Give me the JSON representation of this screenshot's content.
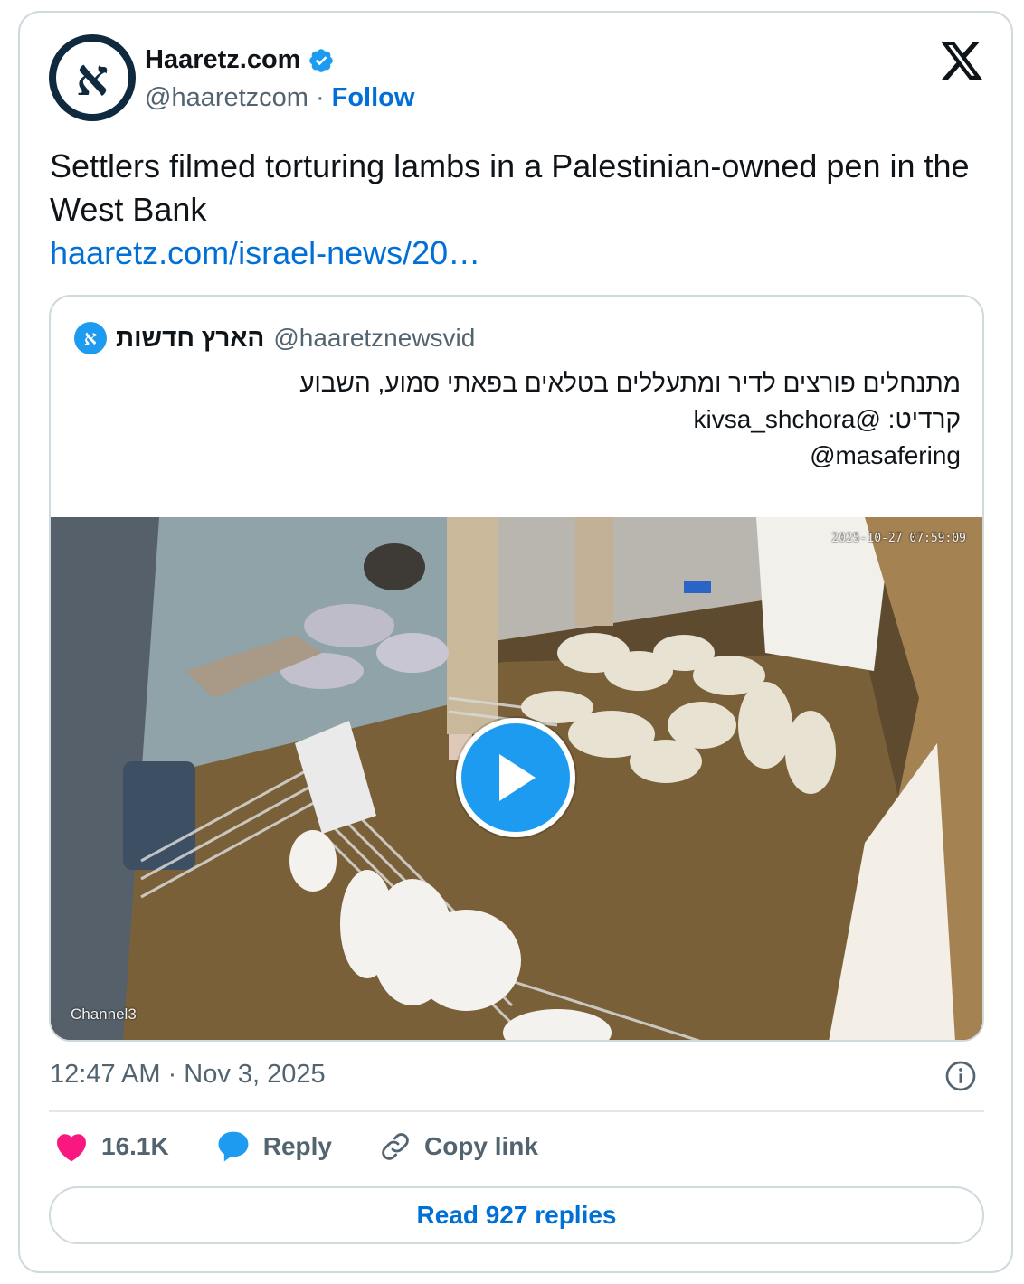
{
  "account": {
    "display_name": "Haaretz.com",
    "handle": "@haaretzcom",
    "separator": "·",
    "follow_label": "Follow",
    "verified": true,
    "avatar_letter": "א"
  },
  "tweet": {
    "text": "Settlers filmed torturing lambs in a Palestinian-owned pen in the West Bank",
    "link": "haaretz.com/israel-news/20…"
  },
  "quote": {
    "display_name": "הארץ חדשות",
    "handle": "@haaretznewsvid",
    "lines": [
      "מתנחלים פורצים לדיר ומתעללים בטלאים בפאתי סמוע, השבוע",
      "קרדיט: @kivsa_shchora",
      "@masafering"
    ],
    "video_timestamp": "2025-10-27 07:59:09",
    "video_channel": "Channel3"
  },
  "meta": {
    "datetime": "12:47 AM · Nov 3, 2025"
  },
  "actions": {
    "like_count": "16.1K",
    "reply_label": "Reply",
    "copy_link_label": "Copy link"
  },
  "read_replies_label": "Read 927 replies",
  "colors": {
    "link": "#006fd6",
    "verified": "#1d9bf0",
    "like": "#f91880",
    "reply": "#1d9bf0"
  },
  "icons": [
    "verified-badge-icon",
    "x-logo-icon",
    "play-icon",
    "info-icon",
    "heart-icon",
    "reply-bubble-icon",
    "link-icon"
  ]
}
